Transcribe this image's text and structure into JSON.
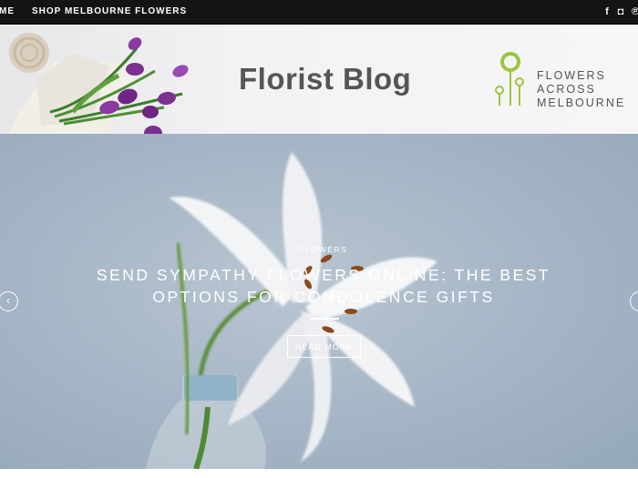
{
  "topbar": {
    "home_label": "ME",
    "shop_label": "SHOP MELBOURNE FLOWERS",
    "social": [
      {
        "icon": "facebook-icon",
        "glyph": "f"
      },
      {
        "icon": "instagram-icon",
        "glyph": "◘"
      },
      {
        "icon": "pinterest-icon",
        "glyph": "℗"
      }
    ]
  },
  "header": {
    "title": "Florist Blog",
    "brand_line1": "FLOWERS",
    "brand_line2": "ACROSS",
    "brand_line3": "MELBOURNE",
    "brand_color": "#9bc53d"
  },
  "slider": {
    "category": "FLOWERS",
    "title": "SEND SYMPATHY FLOWERS ONLINE: THE BEST OPTIONS FOR CONDOLENCE GIFTS",
    "button_label": "READ MORE",
    "prev_glyph": "‹",
    "next_glyph": "›"
  }
}
